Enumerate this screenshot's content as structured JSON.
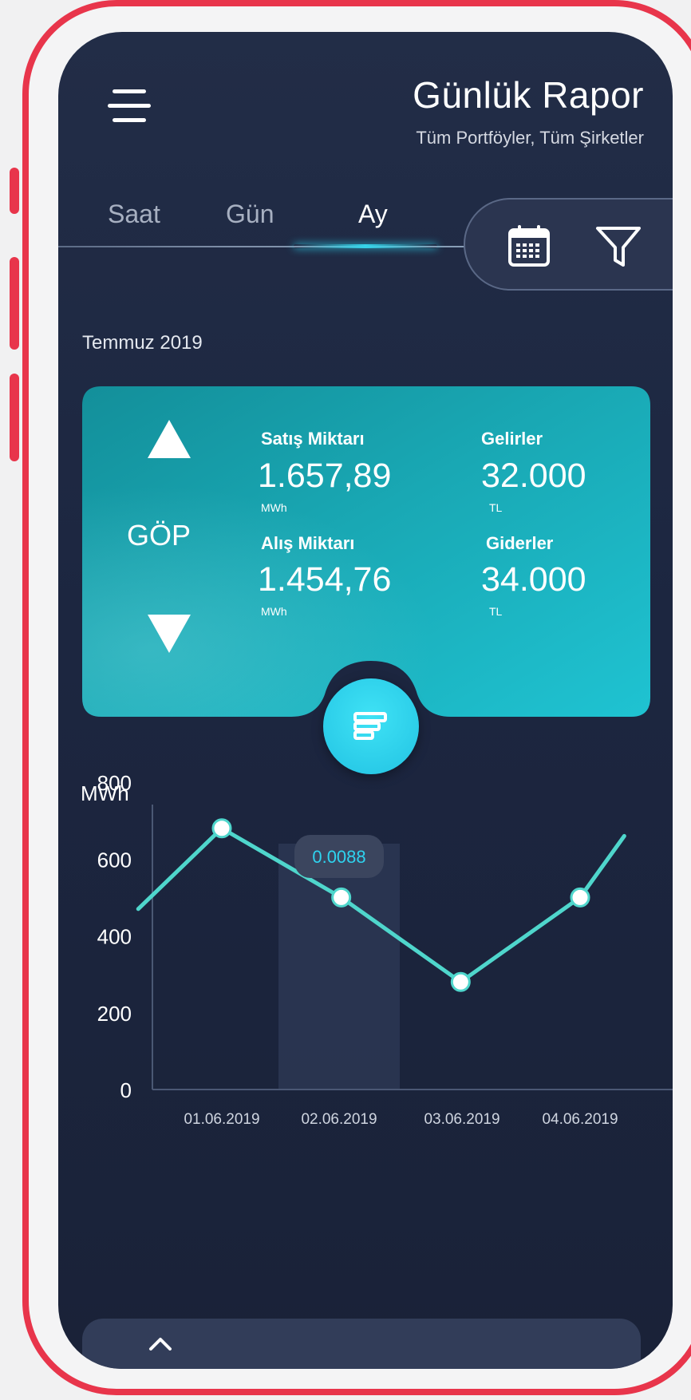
{
  "header": {
    "title": "Günlük Rapor",
    "subtitle": "Tüm Portföyler, Tüm Şirketler"
  },
  "tabs": [
    {
      "label": "Saat",
      "active": false
    },
    {
      "label": "Gün",
      "active": false
    },
    {
      "label": "Ay",
      "active": true
    }
  ],
  "toolbar": {
    "icons": [
      "calendar-icon",
      "filter-icon"
    ]
  },
  "period_label": "Temmuz 2019",
  "summary": {
    "market": "GÖP",
    "sales_label": "Satış Miktarı",
    "sales_value": "1.657,89",
    "sales_unit": "MWh",
    "purchase_label": "Alış Miktarı",
    "purchase_value": "1.454,76",
    "purchase_unit": "MWh",
    "income_label": "Gelirler",
    "income_value": "32.000",
    "income_unit": "TL",
    "expense_label": "Giderler",
    "expense_value": "34.000",
    "expense_unit": "TL"
  },
  "colors": {
    "accent": "#35d4ea",
    "background": "#1d2741",
    "card": "#1aa7b3",
    "frame": "#e8354b"
  },
  "chart_data": {
    "type": "line",
    "ylabel": "MWh",
    "ylim": [
      0,
      800
    ],
    "yticks": [
      0,
      200,
      400,
      600,
      800
    ],
    "categories": [
      "01.06.2019",
      "02.06.2019",
      "03.06.2019",
      "04.06.2019"
    ],
    "x": [
      0.3,
      1,
      2,
      3,
      4,
      4.37
    ],
    "series": [
      {
        "values": [
          470,
          680,
          500,
          280,
          500,
          660
        ]
      }
    ],
    "highlight_category": "02.06.2019",
    "tooltip": "0.0088"
  }
}
